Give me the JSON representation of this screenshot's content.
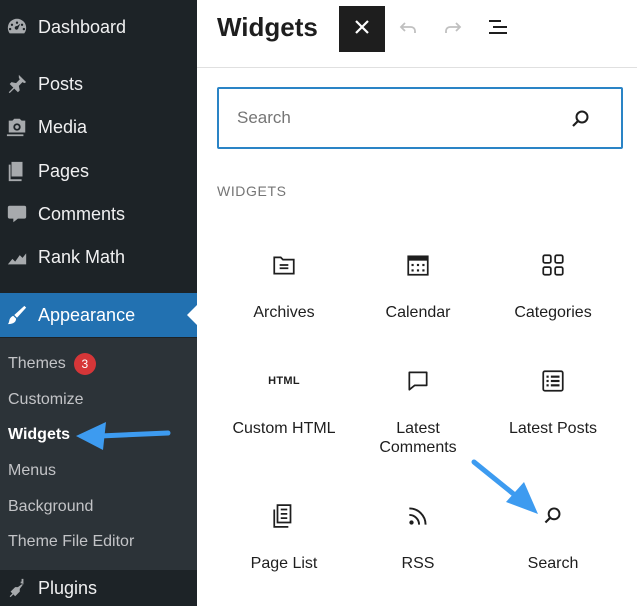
{
  "sidebar": {
    "items": [
      {
        "label": "Dashboard",
        "icon": "dashboard-icon"
      },
      {
        "label": "Posts",
        "icon": "pin-icon"
      },
      {
        "label": "Media",
        "icon": "media-icon"
      },
      {
        "label": "Pages",
        "icon": "pages-icon"
      },
      {
        "label": "Comments",
        "icon": "comment-icon"
      },
      {
        "label": "Rank Math",
        "icon": "chart-icon"
      },
      {
        "label": "Appearance",
        "icon": "brush-icon",
        "active": true
      },
      {
        "label": "Plugins",
        "icon": "plugin-icon"
      }
    ],
    "submenu": [
      {
        "label": "Themes",
        "badge": "3"
      },
      {
        "label": "Customize"
      },
      {
        "label": "Widgets",
        "current": true
      },
      {
        "label": "Menus"
      },
      {
        "label": "Background"
      },
      {
        "label": "Theme File Editor"
      }
    ]
  },
  "header": {
    "title": "Widgets"
  },
  "search": {
    "placeholder": "Search",
    "value": ""
  },
  "category": {
    "label": "WIDGETS"
  },
  "blocks": [
    {
      "label": "Archives",
      "icon": "archive-folder-icon"
    },
    {
      "label": "Calendar",
      "icon": "calendar-icon"
    },
    {
      "label": "Categories",
      "icon": "categories-grid-icon"
    },
    {
      "label": "Custom HTML",
      "icon": "html-icon",
      "glyph": "HTML"
    },
    {
      "label": "Latest Comments",
      "icon": "comment-bubble-icon"
    },
    {
      "label": "Latest Posts",
      "icon": "post-list-icon"
    },
    {
      "label": "Page List",
      "icon": "page-list-icon"
    },
    {
      "label": "RSS",
      "icon": "rss-icon"
    },
    {
      "label": "Search",
      "icon": "search-icon"
    }
  ],
  "colors": {
    "sidebar_bg": "#1d2327",
    "submenu_bg": "#2c3338",
    "accent": "#2271b1",
    "badge": "#d63638",
    "annotation_arrow": "#3d9bf0"
  }
}
